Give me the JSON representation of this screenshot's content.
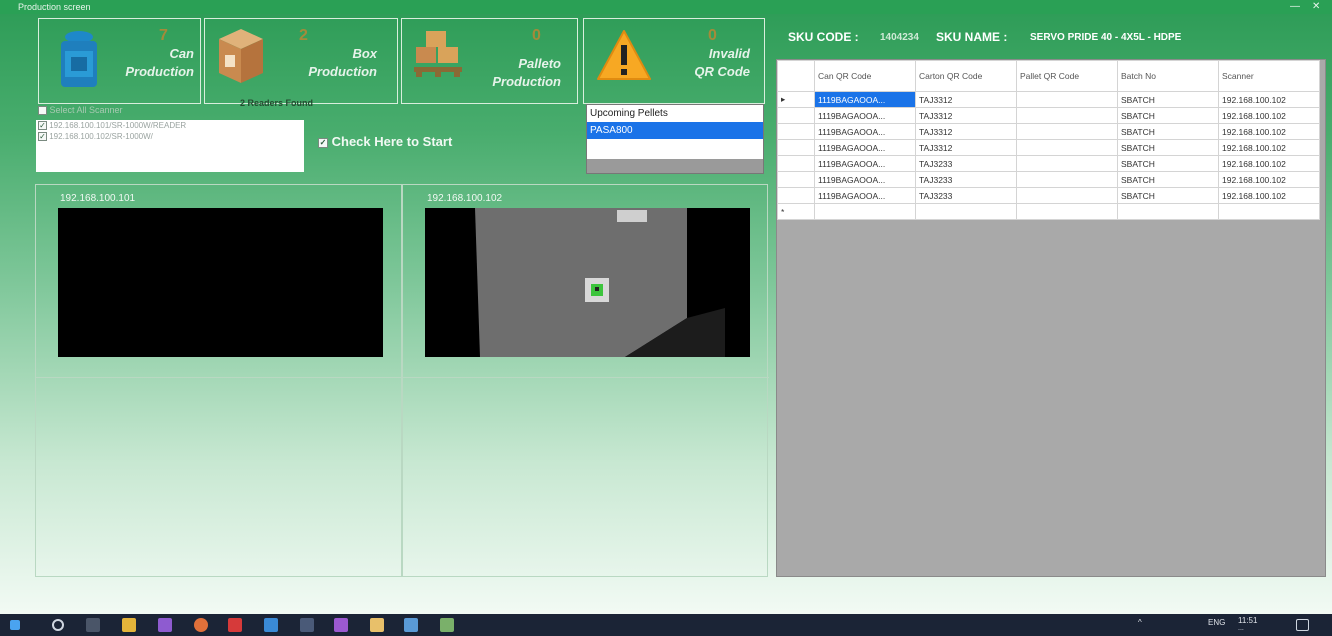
{
  "window": {
    "title": "Production screen",
    "minimize_glyph": "—",
    "close_glyph": "✕"
  },
  "cards": [
    {
      "count": "7",
      "label_line1": "Can",
      "label_line2": "Production",
      "icon": "can-icon"
    },
    {
      "count": "2",
      "label_line1": "Box",
      "label_line2": "Production",
      "icon": "box-icon"
    },
    {
      "count": "0",
      "label_line1": "Palleto",
      "label_line2": "Production",
      "icon": "pallet-icon"
    },
    {
      "count": "0",
      "label_line1": "Invalid",
      "label_line2": "QR Code",
      "icon": "warning-icon"
    }
  ],
  "scanners": {
    "select_all_label": "Select All  Scanner",
    "readers_found": "2 Readers Found",
    "items": [
      "192.168.100.101/SR-1000W/READER",
      "192.168.100.102/SR-1000W/"
    ]
  },
  "start_check_label": "Check Here to Start",
  "upcoming": {
    "header": "Upcoming Pellets",
    "items": [
      "PASA800"
    ]
  },
  "cameras": [
    {
      "ip": "192.168.100.101"
    },
    {
      "ip": "192.168.100.102"
    }
  ],
  "sku": {
    "code_label": "SKU CODE :",
    "code": "1404234",
    "name_label": "SKU NAME :",
    "name": "SERVO PRIDE 40 - 4X5L - HDPE"
  },
  "table": {
    "columns": [
      "Can QR Code",
      "Carton QR Code",
      "Pallet QR Code",
      "Batch No",
      "Scanner"
    ],
    "rows": [
      [
        "1119BAGAOOA...",
        "TAJ3312",
        "",
        "SBATCH",
        "192.168.100.102"
      ],
      [
        "1119BAGAOOA...",
        "TAJ3312",
        "",
        "SBATCH",
        "192.168.100.102"
      ],
      [
        "1119BAGAOOA...",
        "TAJ3312",
        "",
        "SBATCH",
        "192.168.100.102"
      ],
      [
        "1119BAGAOOA...",
        "TAJ3312",
        "",
        "SBATCH",
        "192.168.100.102"
      ],
      [
        "1119BAGAOOA...",
        "TAJ3233",
        "",
        "SBATCH",
        "192.168.100.102"
      ],
      [
        "1119BAGAOOA...",
        "TAJ3233",
        "",
        "SBATCH",
        "192.168.100.102"
      ],
      [
        "1119BAGAOOA...",
        "TAJ3233",
        "",
        "SBATCH",
        "192.168.100.102"
      ]
    ],
    "current_row_marker": "▸",
    "new_row_marker": "*"
  },
  "taskbar": {
    "lang": "ENG",
    "time": "11:51",
    "date": "..."
  }
}
